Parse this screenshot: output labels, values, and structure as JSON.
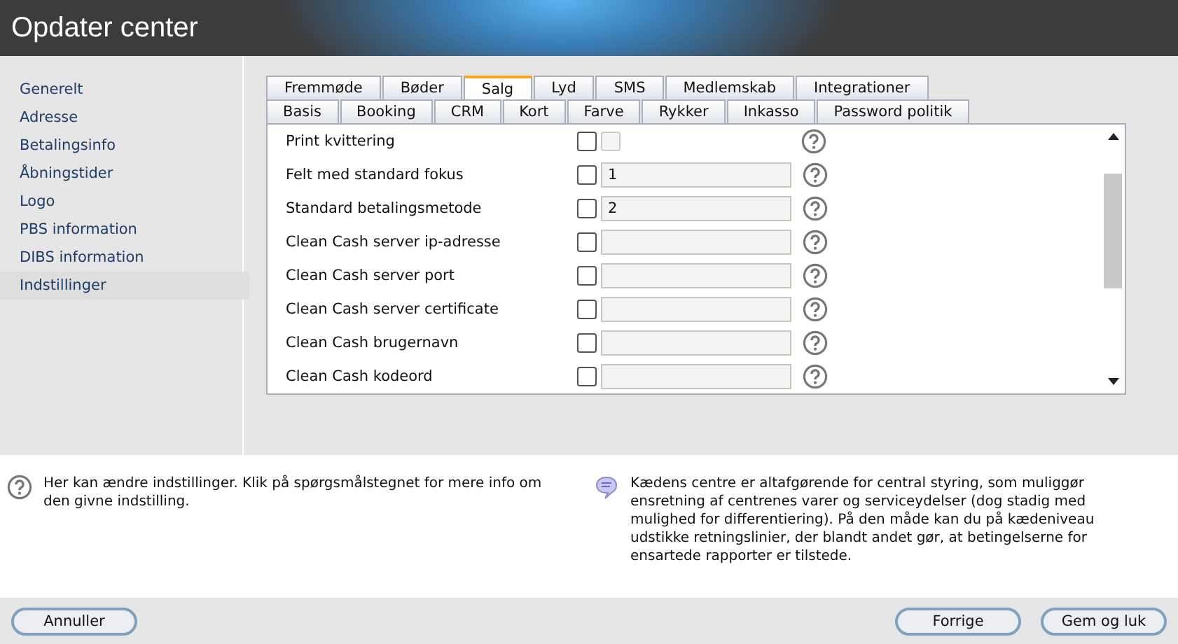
{
  "window": {
    "title": "Opdater center"
  },
  "sidebar": {
    "items": [
      {
        "label": "Generelt",
        "selected": false
      },
      {
        "label": "Adresse",
        "selected": false
      },
      {
        "label": "Betalingsinfo",
        "selected": false
      },
      {
        "label": "Åbningstider",
        "selected": false
      },
      {
        "label": "Logo",
        "selected": false
      },
      {
        "label": "PBS information",
        "selected": false
      },
      {
        "label": "DIBS information",
        "selected": false
      },
      {
        "label": "Indstillinger",
        "selected": true
      }
    ]
  },
  "tabs_row_1": [
    {
      "label": "Fremmøde",
      "selected": false
    },
    {
      "label": "Bøder",
      "selected": false
    },
    {
      "label": "Salg",
      "selected": true
    },
    {
      "label": "Lyd",
      "selected": false
    },
    {
      "label": "SMS",
      "selected": false
    },
    {
      "label": "Medlemskab",
      "selected": false
    },
    {
      "label": "Integrationer",
      "selected": false
    }
  ],
  "tabs_row_2": [
    {
      "label": "Basis",
      "selected": false
    },
    {
      "label": "Booking",
      "selected": false
    },
    {
      "label": "CRM",
      "selected": false
    },
    {
      "label": "Kort",
      "selected": false
    },
    {
      "label": "Farve",
      "selected": false
    },
    {
      "label": "Rykker",
      "selected": false
    },
    {
      "label": "Inkasso",
      "selected": false
    },
    {
      "label": "Password politik",
      "selected": false
    }
  ],
  "settings": [
    {
      "label": "Print kvittering",
      "kind": "check",
      "checked": false,
      "option_disabled": true
    },
    {
      "label": "Felt med standard fokus",
      "kind": "text",
      "checked": false,
      "value": "1"
    },
    {
      "label": "Standard betalingsmetode",
      "kind": "text",
      "checked": false,
      "value": "2"
    },
    {
      "label": "Clean Cash server ip-adresse",
      "kind": "text",
      "checked": false
    },
    {
      "label": "Clean Cash server port",
      "kind": "text",
      "checked": false
    },
    {
      "label": "Clean Cash server certificate",
      "kind": "text",
      "checked": false
    },
    {
      "label": "Clean Cash brugernavn",
      "kind": "text",
      "checked": false
    },
    {
      "label": "Clean Cash kodeord",
      "kind": "text",
      "checked": false
    }
  ],
  "info": {
    "help_text": "Her kan ændre indstillinger. Klik på spørgsmålstegnet for mere info om den givne indstilling.",
    "note_text": "Kædens centre er altafgørende for central styring, som muliggør ensretning af centrenes varer og serviceydelser (dog stadig med mulighed for differentiering). På den måde kan du på kædeniveau udstikke retningslinier, der blandt andet gør, at betingelserne for ensartede rapporter er tilstede."
  },
  "buttons": {
    "cancel": "Annuller",
    "previous": "Forrige",
    "save": "Gem og luk"
  }
}
